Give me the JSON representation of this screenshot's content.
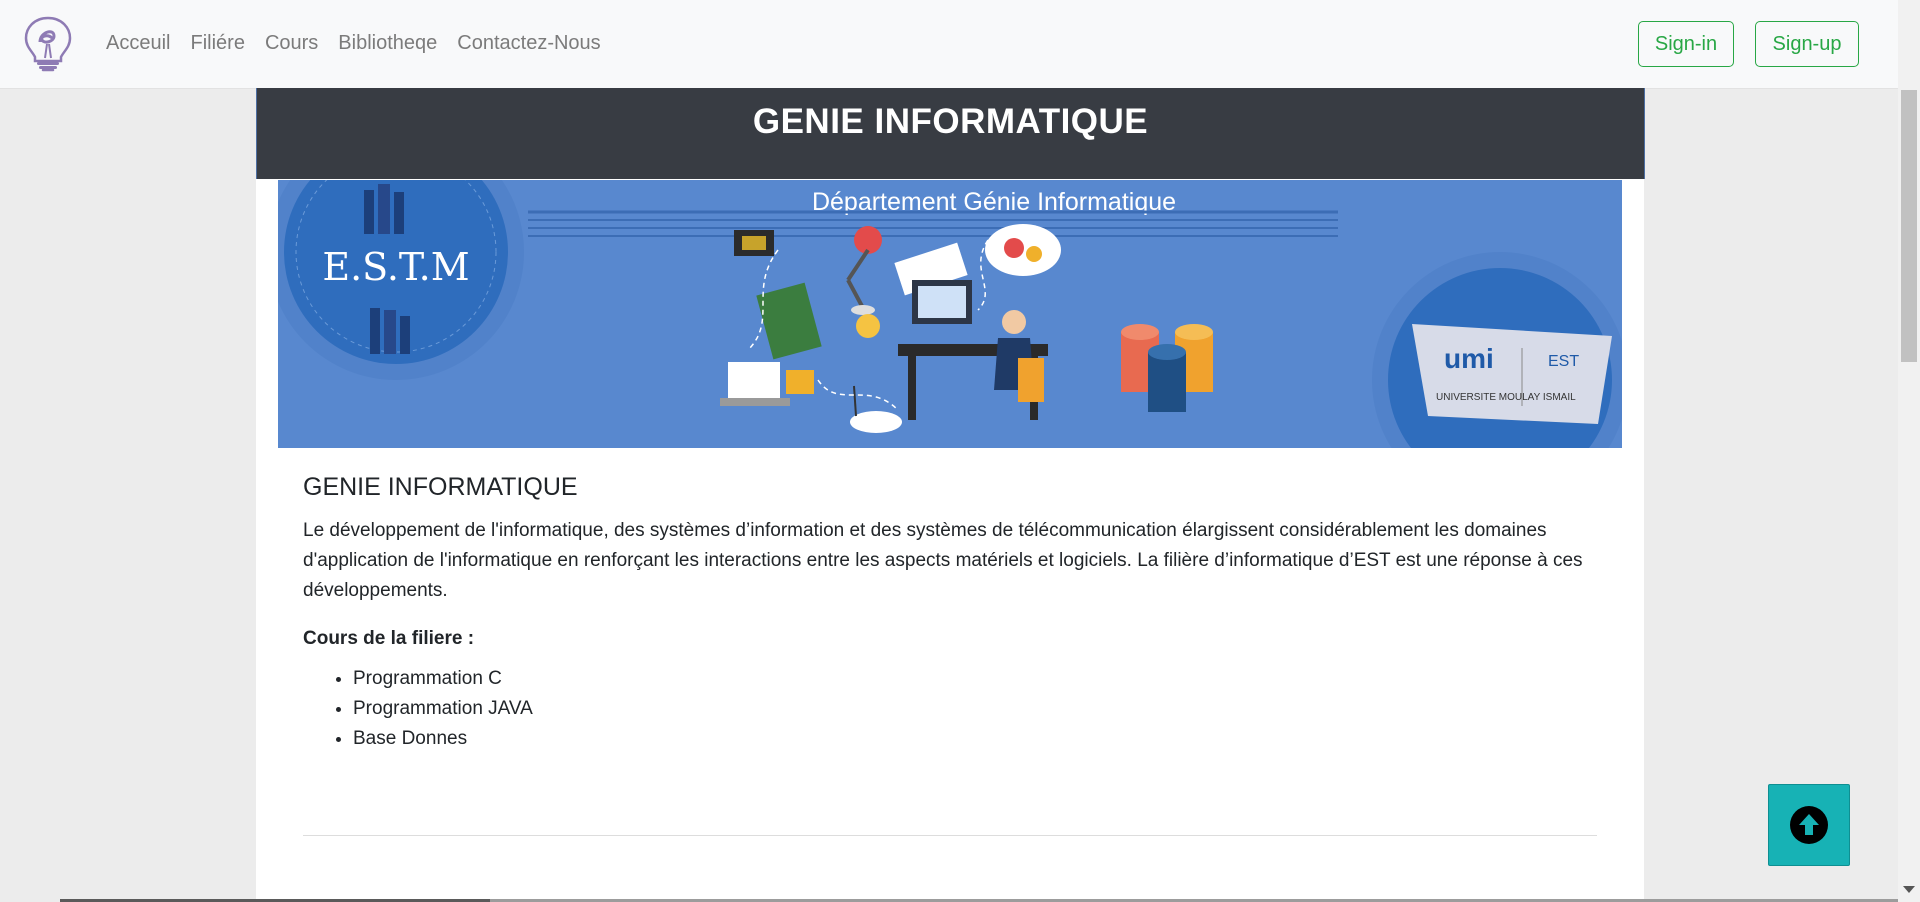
{
  "navbar": {
    "logo": "lightbulb-logo",
    "links": [
      {
        "label": "Acceuil"
      },
      {
        "label": "Filiére"
      },
      {
        "label": "Cours"
      },
      {
        "label": "Bibliotheqe"
      },
      {
        "label": "Contactez-Nous"
      }
    ],
    "signin_label": "Sign-in",
    "signup_label": "Sign-up"
  },
  "header": {
    "title": "GENIE INFORMATIQUE"
  },
  "banner": {
    "heading": "Département Génie Informatique",
    "left_badge": "E.S.T.M",
    "right_badge_brand": "umi",
    "right_badge_line1": "UNIVERSITE MOULAY ISMAIL",
    "right_badge_est": "EST"
  },
  "content": {
    "title": "GENIE INFORMATIQUE",
    "description": "Le développement de l'informatique, des systèmes d’information et des systèmes de télécommunication élargissent considérablement les domaines d'application de l'informatique en renforçant les interactions entre les aspects matériels et logiciels. La filière d’informatique d’EST est une réponse à ces développements.",
    "courses_label": "Cours de la filiere :",
    "courses": [
      "Programmation C",
      "Programmation JAVA",
      "Base Donnes"
    ]
  },
  "back_to_top": {
    "icon": "arrow-up-circle-icon"
  },
  "colors": {
    "accent_green": "#28a745",
    "header_dark": "#383c43",
    "banner_blue": "#5888cf",
    "back_to_top": "#17b2b5"
  }
}
